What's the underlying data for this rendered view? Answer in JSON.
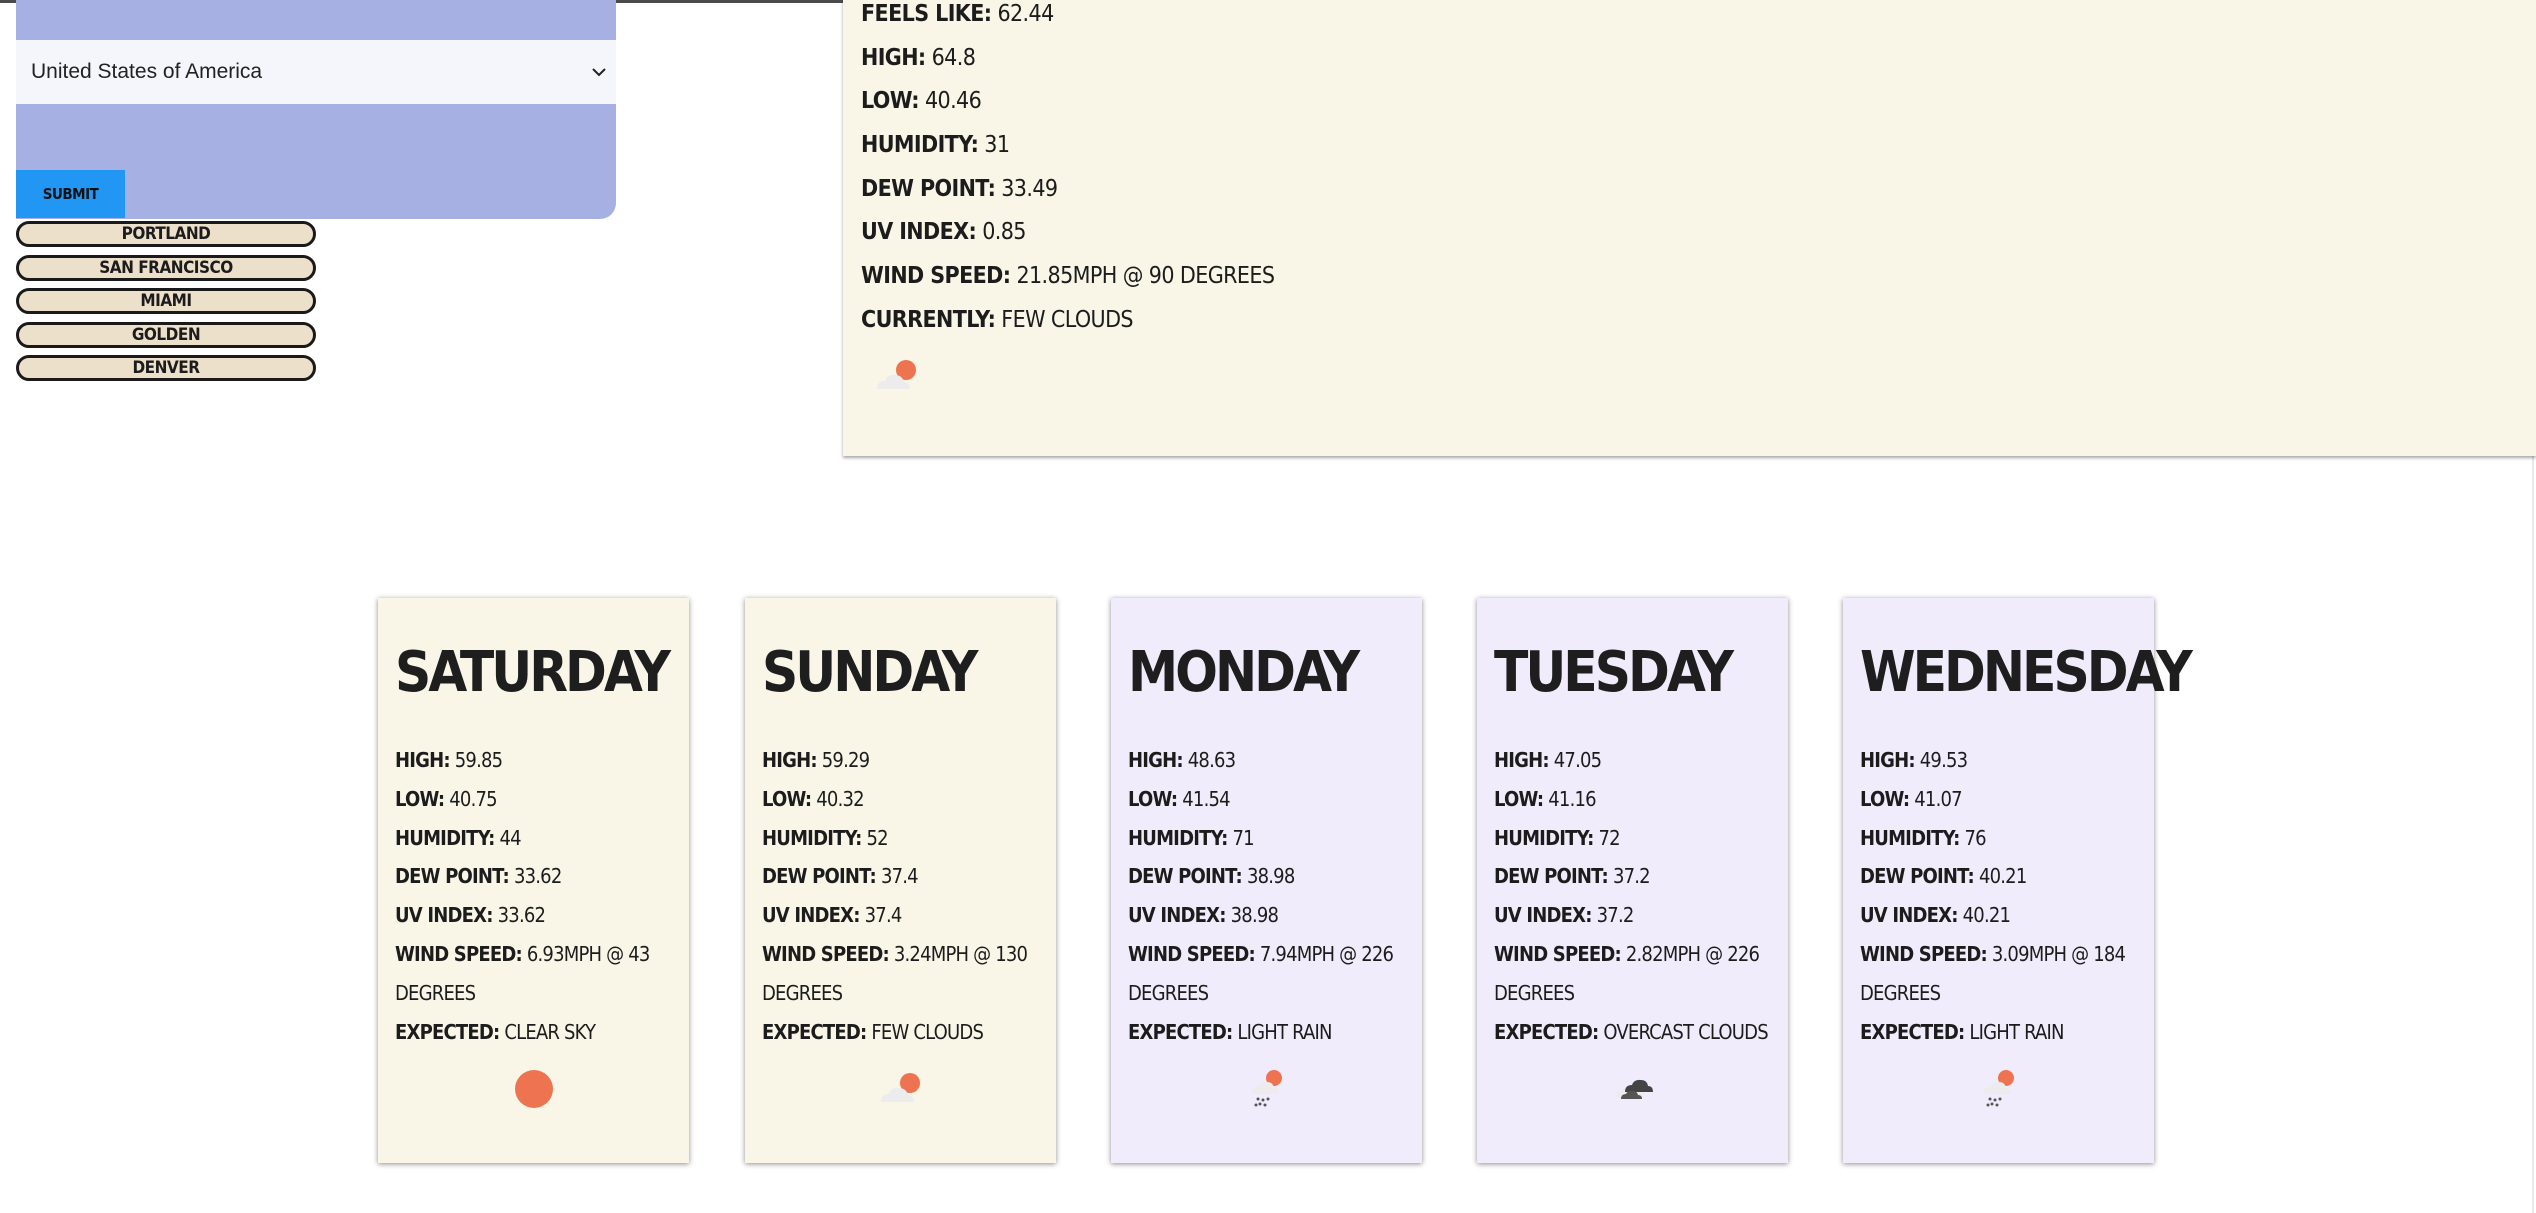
{
  "search": {
    "country_value": "United States of America",
    "submit_label": "SUBMIT"
  },
  "history": [
    "PORTLAND",
    "SAN FRANCISCO",
    "MIAMI",
    "GOLDEN",
    "DENVER"
  ],
  "current": {
    "feels_like_label": "FEELS LIKE:",
    "feels_like": "62.44",
    "high_label": "HIGH:",
    "high": "64.8",
    "low_label": "LOW:",
    "low": "40.46",
    "humidity_label": "HUMIDITY:",
    "humidity": "31",
    "dew_point_label": "DEW POINT:",
    "dew_point": "33.49",
    "uv_index_label": "UV INDEX:",
    "uv_index": "0.85",
    "wind_speed_label": "WIND SPEED:",
    "wind_speed": "21.85MPH @ 90 DEGREES",
    "currently_label": "CURRENTLY:",
    "currently": "FEW CLOUDS",
    "icon": "few-clouds-icon"
  },
  "labels": {
    "high": "HIGH:",
    "low": "LOW:",
    "humidity": "HUMIDITY:",
    "dew_point": "DEW POINT:",
    "uv_index": "UV INDEX:",
    "wind_speed": "WIND SPEED:",
    "expected": "EXPECTED:"
  },
  "forecast": [
    {
      "day": "SATURDAY",
      "high": "59.85",
      "low": "40.75",
      "humidity": "44",
      "dew_point": "33.62",
      "uv_index": "33.62",
      "wind": "6.93MPH @ 43 DEGREES",
      "expected": "CLEAR SKY",
      "icon": "clear-sky-icon"
    },
    {
      "day": "SUNDAY",
      "high": "59.29",
      "low": "40.32",
      "humidity": "52",
      "dew_point": "37.4",
      "uv_index": "37.4",
      "wind": "3.24MPH @ 130 DEGREES",
      "expected": "FEW CLOUDS",
      "icon": "few-clouds-icon"
    },
    {
      "day": "MONDAY",
      "high": "48.63",
      "low": "41.54",
      "humidity": "71",
      "dew_point": "38.98",
      "uv_index": "38.98",
      "wind": "7.94MPH @ 226 DEGREES",
      "expected": "LIGHT RAIN",
      "icon": "light-rain-icon"
    },
    {
      "day": "TUESDAY",
      "high": "47.05",
      "low": "41.16",
      "humidity": "72",
      "dew_point": "37.2",
      "uv_index": "37.2",
      "wind": "2.82MPH @ 226 DEGREES",
      "expected": "OVERCAST CLOUDS",
      "icon": "overcast-clouds-icon"
    },
    {
      "day": "WEDNESDAY",
      "high": "49.53",
      "low": "41.07",
      "humidity": "76",
      "dew_point": "40.21",
      "uv_index": "40.21",
      "wind": "3.09MPH @ 184 DEGREES",
      "expected": "LIGHT RAIN",
      "icon": "light-rain-icon"
    }
  ],
  "colors": {
    "panel": "#a7b0e2",
    "submit": "#2196f3",
    "history_bg": "#ece0cb",
    "warm_card": "#f9f6e8",
    "cool_card": "#f1ecfb",
    "sun": "#ee7350"
  }
}
